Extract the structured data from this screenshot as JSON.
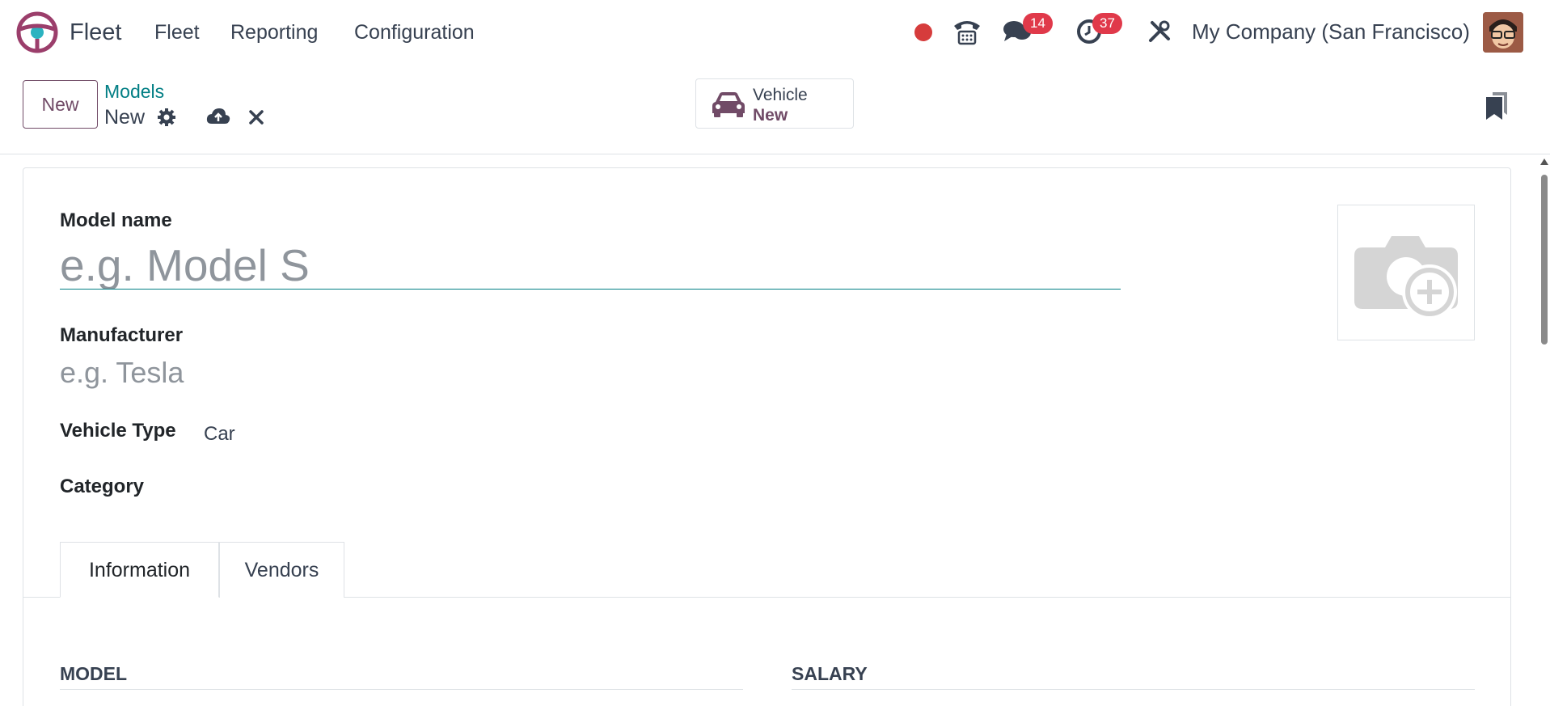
{
  "navbar": {
    "app_name": "Fleet",
    "menu": [
      "Fleet",
      "Reporting",
      "Configuration"
    ],
    "messages_count": "14",
    "activities_count": "37",
    "company": "My Company (San Francisco)",
    "accent": "#714b67",
    "badge_color": "#e0394a",
    "status_color": "#d63c3c"
  },
  "control_panel": {
    "new_label": "New",
    "breadcrumb_parent": "Models",
    "breadcrumb_current": "New",
    "smart_button": {
      "label": "Vehicle",
      "value": "New"
    }
  },
  "form": {
    "model_name_label": "Model name",
    "model_name_placeholder": "e.g. Model S",
    "manufacturer_label": "Manufacturer",
    "manufacturer_placeholder": "e.g. Tesla",
    "vehicle_type_label": "Vehicle Type",
    "vehicle_type_value": "Car",
    "category_label": "Category"
  },
  "tabs": [
    {
      "label": "Information",
      "active": true
    },
    {
      "label": "Vendors",
      "active": false
    }
  ],
  "sections": {
    "model": "MODEL",
    "salary": "SALARY"
  }
}
